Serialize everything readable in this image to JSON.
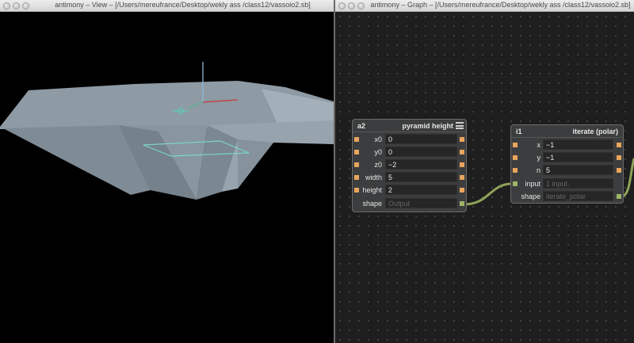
{
  "view_window": {
    "title": "antimony – View – [/Users/mereufrance/Desktop/wekly ass /class12/vassoio2.sb]"
  },
  "graph_window": {
    "title": "antimony – Graph – [/Users/mereufrance/Desktop/wekly ass /class12/vassoio2.sb]"
  },
  "nodes": [
    {
      "id": "a2",
      "type": "pyramid height",
      "rows": [
        {
          "label": "x0",
          "value": "0"
        },
        {
          "label": "y0",
          "value": "0"
        },
        {
          "label": "z0",
          "value": "−2"
        },
        {
          "label": "width",
          "value": "5"
        },
        {
          "label": "height",
          "value": "2"
        }
      ],
      "output": {
        "label": "shape",
        "placeholder": "Output"
      }
    },
    {
      "id": "i1",
      "type": "iterate (polar)",
      "rows": [
        {
          "label": "x",
          "value": "−1"
        },
        {
          "label": "y",
          "value": "−1"
        },
        {
          "label": "n",
          "value": "5"
        }
      ],
      "input": {
        "label": "input",
        "placeholder": "1 input."
      },
      "output": {
        "label": "shape",
        "placeholder": "iterate_polar"
      }
    }
  ],
  "colors": {
    "port_orange": "#e9a55d",
    "port_green": "#9db567",
    "shape_fill": "#8e9aa5",
    "axis_x": "#c63a3a",
    "axis_y": "#5ab48c",
    "axis_z": "#8fb7d6",
    "wire": "#8fa35a"
  },
  "icons": {
    "node_menu": "hamburger-menu-icon",
    "window_controls": "traffic-light-icon"
  }
}
